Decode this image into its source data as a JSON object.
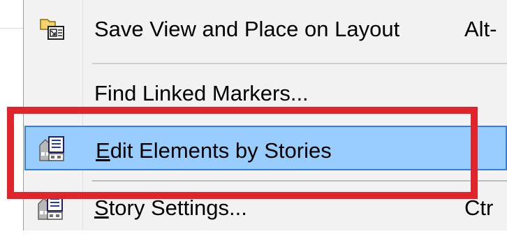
{
  "menu": {
    "items": [
      {
        "label": "Save View and Place on Layout",
        "shortcut": "Alt-",
        "icon": "save-view-place-layout-icon"
      },
      {
        "label": "Find Linked Markers...",
        "shortcut": "",
        "icon": ""
      },
      {
        "label_mnemonic": "E",
        "label_rest": "dit Elements by Stories",
        "shortcut": "",
        "icon": "edit-elements-by-stories-icon",
        "highlighted": true
      },
      {
        "label_mnemonic": "S",
        "label_rest": "tory Settings...",
        "shortcut": "Ctr",
        "icon": "story-settings-icon"
      }
    ]
  },
  "colors": {
    "menu_background": "#f2f2f2",
    "highlight_background": "#99ccff",
    "highlight_border": "#3a7cd6",
    "annotation_red": "#e0242b"
  }
}
